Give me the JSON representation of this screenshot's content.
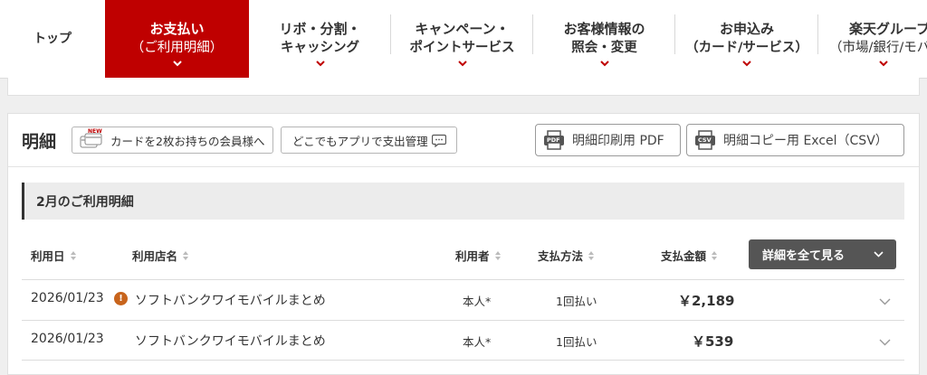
{
  "nav": {
    "items": [
      {
        "line1": "トップ",
        "line2": ""
      },
      {
        "line1": "お支払い",
        "line2": "（ご利用明細）"
      },
      {
        "line1": "リボ・分割・",
        "line2": "キャッシング"
      },
      {
        "line1": "キャンペーン・",
        "line2": "ポイントサービス"
      },
      {
        "line1": "お客様情報の",
        "line2": "照会・変更"
      },
      {
        "line1": "お申込み",
        "line2": "（カード/サービス）"
      },
      {
        "line1": "楽天グループ",
        "line2": "（市場/銀行/モバイ"
      }
    ],
    "active_color": "#bf0000"
  },
  "panel": {
    "title": "明細",
    "multi_card_label": "カードを2枚お持ちの会員様へ",
    "new_badge": "NEW",
    "app_label": "どこでもアプリで支出管理",
    "print_pdf_label": "明細印刷用 PDF",
    "pdf_icon_text": "PDF",
    "copy_csv_label": "明細コピー用 Excel（CSV）",
    "csv_icon_text": "CSV"
  },
  "statement": {
    "month_title": "2月のご利用明細",
    "columns": {
      "date": "利用日",
      "store": "利用店名",
      "user": "利用者",
      "method": "支払方法",
      "amount": "支払金額"
    },
    "show_all_label": "詳細を全て見る",
    "rows": [
      {
        "date": "2026/01/23",
        "store": "ソフトバンクワイモバイルまとめ",
        "user": "本人*",
        "method": "1回払い",
        "amount": "￥2,189",
        "info": "!"
      },
      {
        "date": "2026/01/23",
        "store": "ソフトバンクワイモバイルまとめ",
        "user": "本人*",
        "method": "1回払い",
        "amount": "￥539",
        "info": ""
      }
    ]
  },
  "colors": {
    "brand_red": "#bf0000",
    "info_orange": "#c8641c",
    "dark_button": "#555555"
  }
}
